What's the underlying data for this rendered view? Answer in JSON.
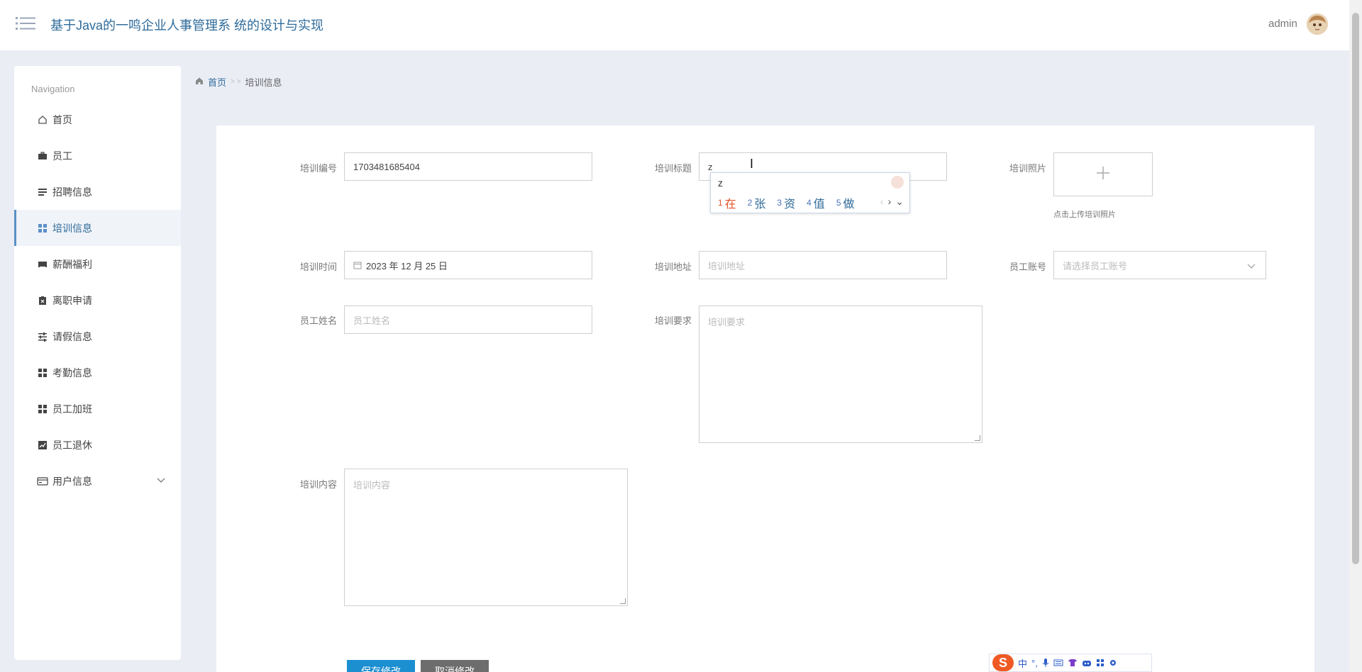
{
  "header": {
    "title": "基于Java的一鸣企业人事管理系 统的设计与实现",
    "user": "admin"
  },
  "sidebar": {
    "title": "Navigation",
    "items": [
      {
        "label": "首页",
        "icon": "home-icon"
      },
      {
        "label": "员工",
        "icon": "briefcase-icon"
      },
      {
        "label": "招聘信息",
        "icon": "list-icon"
      },
      {
        "label": "培训信息",
        "icon": "grid-icon",
        "active": true
      },
      {
        "label": "薪酬福利",
        "icon": "inbox-icon"
      },
      {
        "label": "离职申请",
        "icon": "clipboard-icon"
      },
      {
        "label": "请假信息",
        "icon": "sliders-icon"
      },
      {
        "label": "考勤信息",
        "icon": "grid-icon"
      },
      {
        "label": "员工加班",
        "icon": "grid-icon"
      },
      {
        "label": "员工退休",
        "icon": "chart-icon"
      },
      {
        "label": "用户信息",
        "icon": "card-icon",
        "expandable": true
      }
    ]
  },
  "breadcrumb": {
    "home": "首页",
    "separator": "> >",
    "current": "培训信息"
  },
  "form": {
    "training_no": {
      "label": "培训编号",
      "value": "1703481685404"
    },
    "training_title": {
      "label": "培训标题",
      "value": "z"
    },
    "training_photo": {
      "label": "培训照片",
      "hint": "点击上传培训照片"
    },
    "training_time": {
      "label": "培训时间",
      "value": "2023 年 12 月 25 日"
    },
    "training_address": {
      "label": "培训地址",
      "placeholder": "培训地址"
    },
    "employee_account": {
      "label": "员工账号",
      "placeholder": "请选择员工账号"
    },
    "employee_name": {
      "label": "员工姓名",
      "placeholder": "员工姓名"
    },
    "training_requirement": {
      "label": "培训要求",
      "placeholder": "培训要求"
    },
    "training_content": {
      "label": "培训内容",
      "placeholder": "培训内容"
    },
    "save_label": "保存修改",
    "cancel_label": "取消修改"
  },
  "ime": {
    "input": "z",
    "candidates": [
      {
        "num": "1",
        "word": "在"
      },
      {
        "num": "2",
        "word": "张"
      },
      {
        "num": "3",
        "word": "资"
      },
      {
        "num": "4",
        "word": "值"
      },
      {
        "num": "5",
        "word": "做"
      }
    ],
    "toolbar_mode": "中",
    "toolbar_punct": "°,"
  },
  "colors": {
    "accent": "#2f6b9a",
    "save_button": "#1c8fd1",
    "cancel_button": "#6d6d6d",
    "ime_logo": "#ef5a24"
  }
}
